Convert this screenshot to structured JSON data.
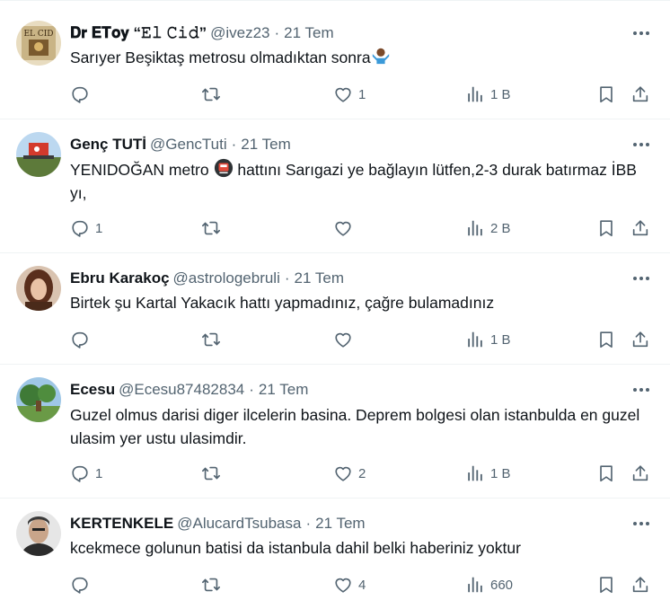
{
  "tweets": [
    {
      "name": "𝐃𝐫 𝐄𝐓𝐨𝐲 “𝙴𝚕 𝙲𝚒𝚍”",
      "handle": "@ivez23",
      "separator": "·",
      "time": "21 Tem",
      "text": "Sarıyer Beşiktaş metrosu olmadıktan sonra",
      "emoji": "person-shrugging-emoji",
      "avatar_text": "EL CID",
      "replies": "",
      "retweets": "",
      "likes": "1",
      "views": "1 B"
    },
    {
      "name": "Genç TUTİ",
      "handle": "@GencTuti",
      "separator": "·",
      "time": "21 Tem",
      "text_before": "YENIDOĞAN metro",
      "text_after": "hattını Sarıgazi ye bağlayın lütfen,2-3 durak batırmaz İBB yı,",
      "emoji": "metro-emoji",
      "replies": "1",
      "retweets": "",
      "likes": "",
      "views": "2 B"
    },
    {
      "name": "Ebru Karakoç",
      "handle": "@astrologebruli",
      "separator": "·",
      "time": "21 Tem",
      "text": "Birtek şu Kartal Yakacık hattı yapmadınız, çağre bulamadınız",
      "replies": "",
      "retweets": "",
      "likes": "",
      "views": "1 B"
    },
    {
      "name": "Ecesu",
      "handle": "@Ecesu87482834",
      "separator": "·",
      "time": "21 Tem",
      "text": "Guzel olmus darisi diger ilcelerin basina. Deprem bolgesi olan istanbulda en guzel ulasim yer ustu ulasimdir.",
      "replies": "1",
      "retweets": "",
      "likes": "2",
      "views": "1 B"
    },
    {
      "name": "KERTENKELE",
      "handle": "@AlucardTsubasa",
      "separator": "·",
      "time": "21 Tem",
      "text": "kcekmece golunun batisi da istanbula dahil belki haberiniz yoktur",
      "replies": "",
      "retweets": "",
      "likes": "4",
      "views": "660"
    }
  ],
  "icons": {
    "reply": "reply-icon",
    "retweet": "retweet-icon",
    "like": "heart-icon",
    "views": "views-icon",
    "bookmark": "bookmark-icon",
    "share": "share-icon",
    "more": "more-icon"
  },
  "colors": {
    "text": "#0f1419",
    "secondary": "#536471",
    "divider": "#eff3f4"
  }
}
